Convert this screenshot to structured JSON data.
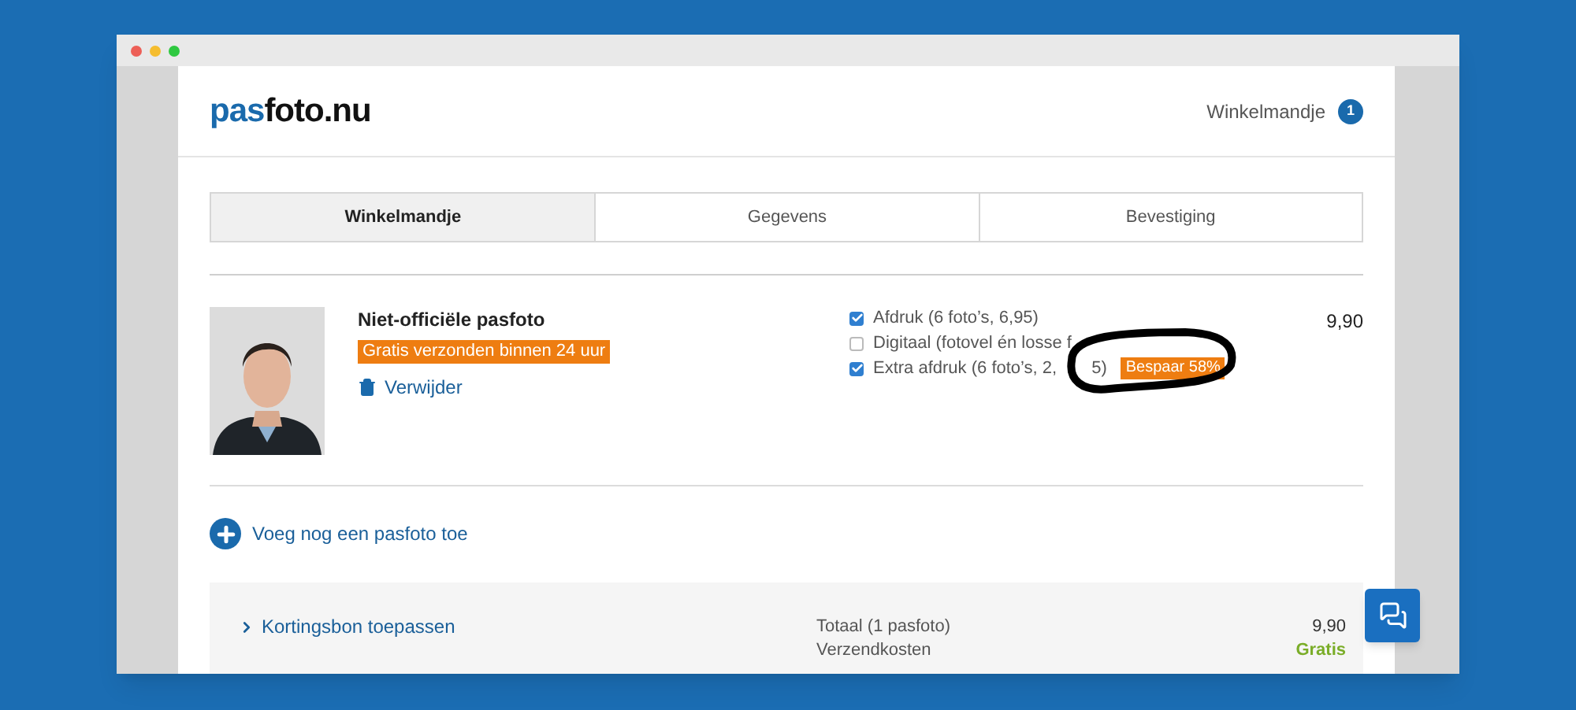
{
  "window": {
    "controls": [
      {
        "color": "#ed5f57"
      },
      {
        "color": "#f5bd2f"
      },
      {
        "color": "#2ec840"
      }
    ]
  },
  "header": {
    "logo": [
      {
        "text": "pas",
        "color": "#1a6aac"
      },
      {
        "text": "foto.nu",
        "color": "#111111"
      }
    ],
    "cart_link": "Winkelmandje",
    "cart_count": "1"
  },
  "steps": [
    {
      "label": "Winkelmandje",
      "selected": true
    },
    {
      "label": "Gegevens",
      "selected": false
    },
    {
      "label": "Bevestiging",
      "selected": false
    }
  ],
  "product": {
    "title": "Niet-officiële pasfoto",
    "badge": "Gratis verzonden binnen 24 uur",
    "remove": "Verwijder",
    "price": "9,90",
    "options": [
      {
        "parts": [
          "Afdruk (6 foto’s, 6,95)"
        ],
        "checked": true
      },
      {
        "parts": [
          "Digitaal (fotovel én losse f"
        ],
        "checked": false
      },
      {
        "parts": [
          "Extra afdruk (6 foto’s, 2,",
          "5)"
        ],
        "checked": true,
        "badge": "Bespaar 58%"
      }
    ]
  },
  "add_photo": "Voeg nog een pasfoto toe",
  "discount": "Kortingsbon toepassen",
  "summary": [
    {
      "label": "Totaal (1 pasfoto)",
      "value": "9,90",
      "kind": "price"
    },
    {
      "label": "Verzendkosten",
      "value": "Gratis",
      "kind": "free"
    }
  ]
}
